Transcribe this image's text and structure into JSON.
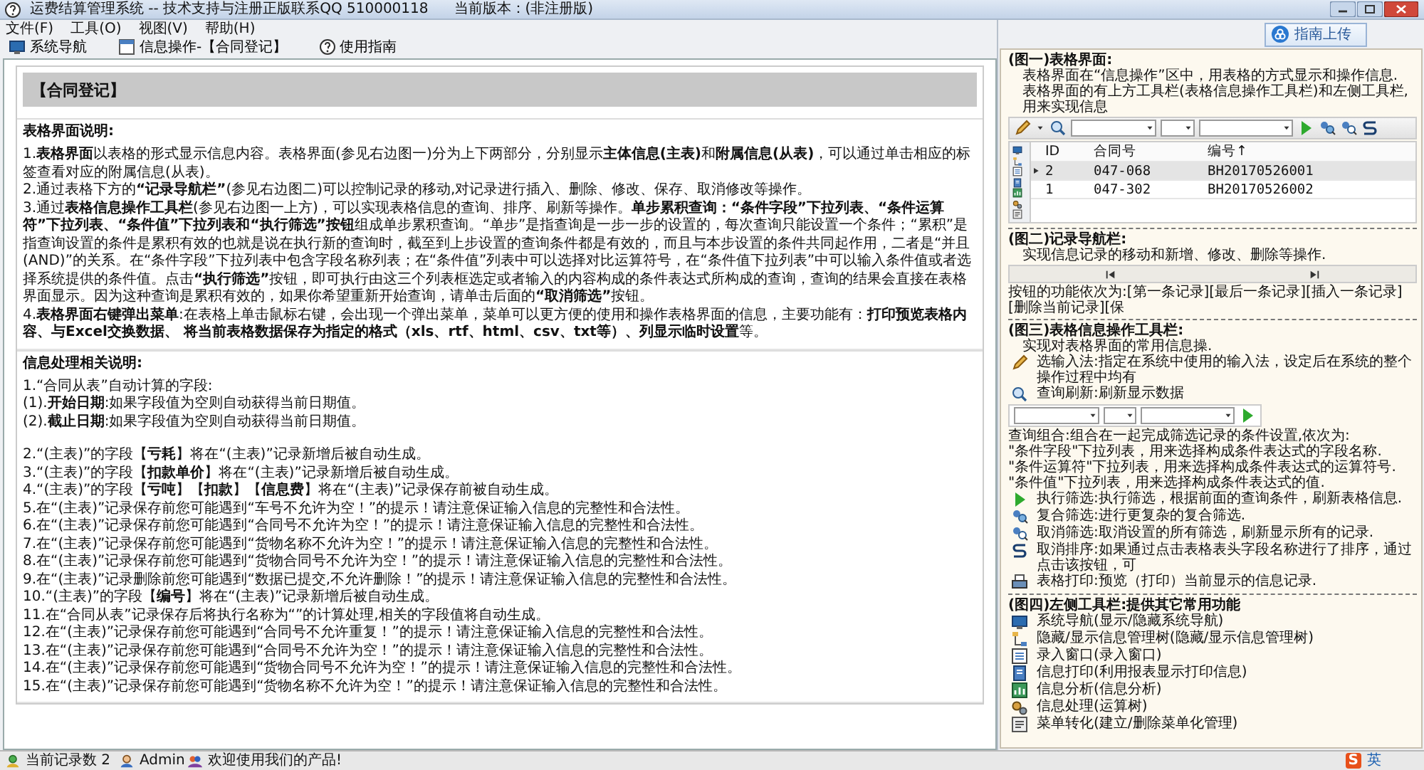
{
  "window": {
    "title": "运费结算管理系统 -- 技术支持与注册正版联系QQ 510000118",
    "version": "当前版本：(非注册版)"
  },
  "menu": [
    "文件(F)",
    "工具(O)",
    "视图(V)",
    "帮助(H)"
  ],
  "toolbar": [
    {
      "label": "系统导航",
      "kind": "navigation"
    },
    {
      "label": "信息操作-【合同登记】",
      "kind": "window"
    },
    {
      "label": "使用指南",
      "kind": "help"
    }
  ],
  "document": {
    "header": "【合同登记】",
    "sections": [
      {
        "title": "表格界面说明:",
        "groups": [
          [
            "1.**表格界面**以表格的形式显示信息内容。表格界面(参见右边图一)分为上下两部分，分别显示**主体信息(主表)**和**附属信息(从表)**，可以通过单击相应的标签查看对应的附属信息(从表)。",
            "2.通过表格下方的**“记录导航栏”**(参见右边图二)可以控制记录的移动,对记录进行插入、删除、修改、保存、取消修改等操作。",
            "3.通过**表格信息操作工具栏**(参见右边图一上方)，可以实现表格信息的查询、排序、刷新等操作。**单步累积查询：“条件字段”下拉列表、“条件运算符”下拉列表、“条件值”下拉列表和“执行筛选”按钮**组成单步累积查询。“单步”是指查询是一步一步的设置的，每次查询只能设置一个条件；“累积”是指查询设置的条件是累积有效的也就是说在执行新的查询时，截至到上步设置的查询条件都是有效的，而且与本步设置的条件共同起作用，二者是“并且(AND)”的关系。在“条件字段”下拉列表中包含字段名称列表；在“条件值”列表中可以选择对比运算符号，在“条件值下拉列表”中可以输入条件值或者选择系统提供的条件值。点击**“执行筛选”**按钮，即可执行由这三个列表框选定或者输入的内容构成的条件表达式所构成的查询，查询的结果会直接在表格界面显示。因为这种查询是累积有效的，如果你希望重新开始查询，请单击后面的**“取消筛选”**按钮。",
            "4.**表格界面右键弹出菜单**:在表格上单击鼠标右键，会出现一个弹出菜单，菜单可以更方便的使用和操作表格界面的信息，主要功能有：**打印预览表格内容、与Excel交换数据、 将当前表格数据保存为指定的格式（xls、rtf、html、csv、txt等）、列显示临时设置**等。"
          ]
        ]
      },
      {
        "title": "信息处理相关说明:",
        "groups": [
          [
            "1.“合同从表”自动计算的字段:",
            "(1).**开始日期**:如果字段值为空则自动获得当前日期值。",
            "(2).**截止日期**:如果字段值为空则自动获得当前日期值。"
          ],
          [
            "2.“(主表)”的字段【**亏耗**】将在“(主表)”记录新增后被自动生成。",
            "3.“(主表)”的字段【**扣款单价**】将在“(主表)”记录新增后被自动生成。",
            "4.“(主表)”的字段【**亏吨**】【**扣款**】【**信息费**】将在“(主表)”记录保存前被自动生成。",
            "5.在“(主表)”记录保存前您可能遇到“车号不允许为空！”的提示！请注意保证输入信息的完整性和合法性。",
            "6.在“(主表)”记录保存前您可能遇到“合同号不允许为空！”的提示！请注意保证输入信息的完整性和合法性。",
            "7.在“(主表)”记录保存前您可能遇到“货物名称不允许为空！”的提示！请注意保证输入信息的完整性和合法性。",
            "8.在“(主表)”记录保存前您可能遇到“货物合同号不允许为空！”的提示！请注意保证输入信息的完整性和合法性。",
            "9.在“(主表)”记录删除前您可能遇到“数据已提交,不允许删除！”的提示！请注意保证输入信息的完整性和合法性。",
            "10.“(主表)”的字段【**编号**】将在“(主表)”记录新增后被自动生成。",
            "11.在“合同从表”记录保存后将执行名称为“”的计算处理,相关的字段值将自动生成。",
            "12.在“(主表)”记录保存前您可能遇到“合同号不允许重复！”的提示！请注意保证输入信息的完整性和合法性。",
            "13.在“(主表)”记录保存前您可能遇到“合同号不允许为空！”的提示！请注意保证输入信息的完整性和合法性。",
            "14.在“(主表)”记录保存前您可能遇到“货物合同号不允许为空！”的提示！请注意保证输入信息的完整性和合法性。",
            "15.在“(主表)”记录保存前您可能遇到“货物名称不允许为空！”的提示！请注意保证输入信息的完整性和合法性。"
          ]
        ]
      }
    ]
  },
  "help_panel": {
    "upload_button": "指南上传",
    "sections": [
      {
        "title": "(图一)表格界面:",
        "blocks": [
          {
            "kind": "text",
            "text": "表格界面在“信息操作”区中，用表格的方式显示和操作信息."
          },
          {
            "kind": "text",
            "text": "表格界面的有上方工具栏(表格信息操作工具栏)和左侧工具栏,用来实现信息"
          },
          {
            "kind": "table_toolbar"
          },
          {
            "kind": "grid",
            "columns": [
              "ID",
              "合同号",
              "编号↑"
            ],
            "rows": [
              {
                "cells": [
                  "2",
                  "047-068",
                  "BH20170526001"
                ],
                "selected": true
              },
              {
                "cells": [
                  "1",
                  "047-302",
                  "BH20170526002"
                ],
                "selected": false
              }
            ]
          }
        ]
      },
      {
        "title": "(图二)记录导航栏:",
        "blocks": [
          {
            "kind": "text",
            "text": "实现信息记录的移动和新增、修改、删除等操作."
          },
          {
            "kind": "nav_bar"
          },
          {
            "kind": "note",
            "text": "按钮的功能依次为:[第一条记录][最后一条记录][插入一条记录][删除当前记录][保"
          }
        ]
      },
      {
        "title": "(图三)表格信息操作工具栏:",
        "blocks": [
          {
            "kind": "text",
            "text": "实现对表格界面的常用信息操."
          },
          {
            "kind": "input_method",
            "text": "选输入法:指定在系统中使用的输入法，设定后在系统的整个操作过程中均有"
          },
          {
            "kind": "refresh",
            "text": "查询刷新:刷新显示数据"
          },
          {
            "kind": "filter_bar"
          },
          {
            "kind": "note",
            "text": "查询组合:组合在一起完成筛选记录的条件设置,依次为:"
          },
          {
            "kind": "note",
            "text": "\"条件字段\"下拉列表，用来选择构成条件表达式的字段名称."
          },
          {
            "kind": "note",
            "text": "\"条件运算符\"下拉列表，用来选择构成条件表达式的运算符号."
          },
          {
            "kind": "note",
            "text": "\"条件值\"下拉列表，用来选择构成条件表达式的值."
          },
          {
            "kind": "filter",
            "text": "执行筛选:执行筛选，根据前面的查询条件，刷新表格信息."
          },
          {
            "kind": "compound_filter",
            "text": "复合筛选:进行更复杂的复合筛选."
          },
          {
            "kind": "clear_filter",
            "text": "取消筛选:取消设置的所有筛选，刷新显示所有的记录."
          },
          {
            "kind": "clear_sort",
            "text": "取消排序:如果通过点击表格表头字段名称进行了排序，通过点击该按钮，可"
          },
          {
            "kind": "print",
            "text": "表格打印:预览（打印）当前显示的信息记录."
          }
        ]
      },
      {
        "title": "(图四)左侧工具栏:提供其它常用功能",
        "blocks": [
          {
            "kind": "navigation",
            "text": "系统导航(显示/隐藏系统导航)"
          },
          {
            "kind": "tree",
            "text": "隐藏/显示信息管理树(隐藏/显示信息管理树)"
          },
          {
            "kind": "entry",
            "text": "录入窗口(录入窗口)"
          },
          {
            "kind": "report",
            "text": "信息打印(利用报表显示打印信息)"
          },
          {
            "kind": "analysis",
            "text": "信息分析(信息分析)"
          },
          {
            "kind": "process",
            "text": "信息处理(运算树)"
          },
          {
            "kind": "menu",
            "text": "菜单转化(建立/删除菜单化管理)"
          }
        ]
      }
    ]
  },
  "status_bar": [
    {
      "kind": "records",
      "text": "当前记录数 2"
    },
    {
      "kind": "user",
      "text": "Admin"
    },
    {
      "kind": "welcome",
      "text": "欢迎使用我们的产品!"
    }
  ],
  "ime_bar": {
    "logo": "S",
    "mode": "英"
  }
}
